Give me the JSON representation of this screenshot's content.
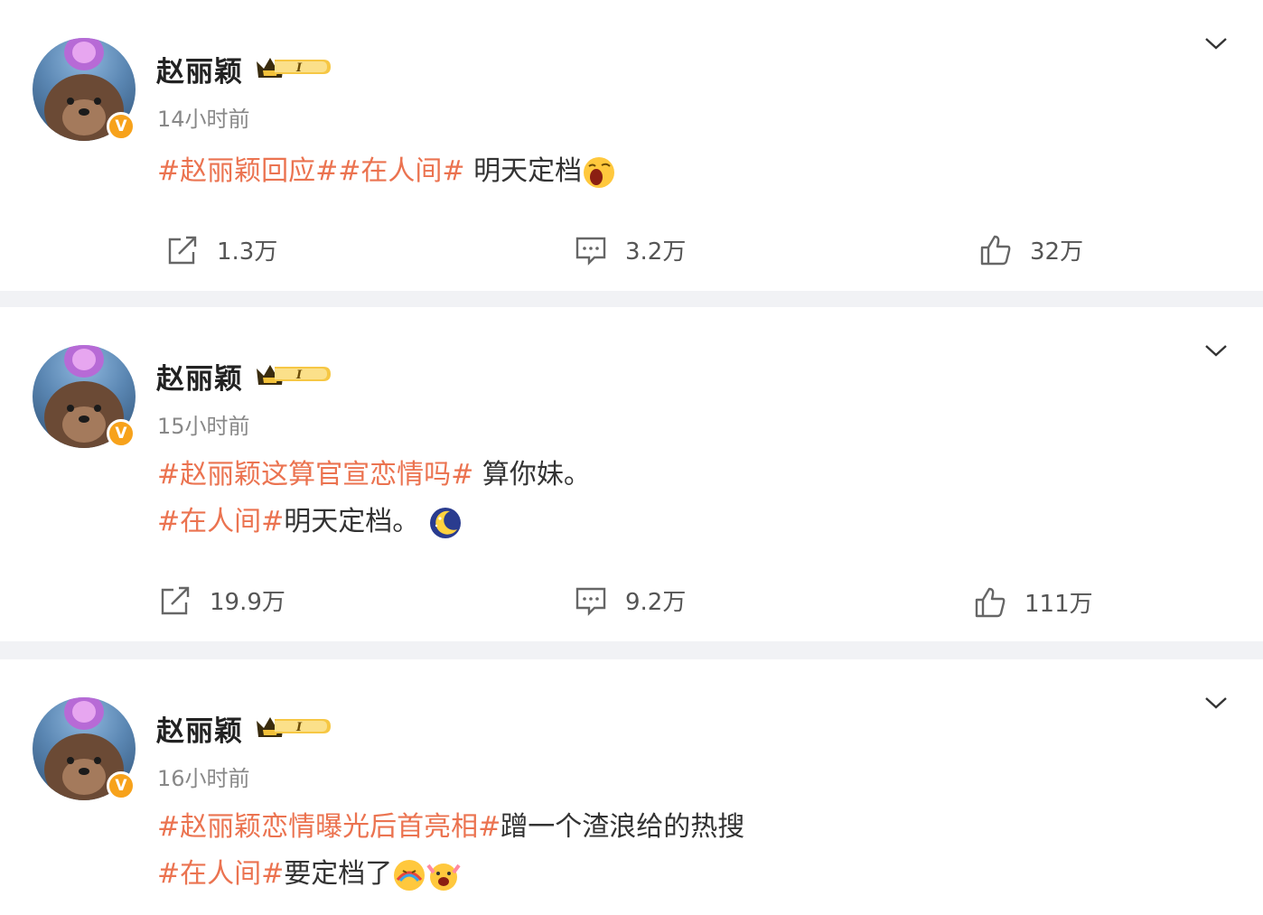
{
  "posts": [
    {
      "username": "赵丽颖",
      "verified_badge": "V",
      "vip_icon": "crown-vip-level-icon",
      "time": "14小时前",
      "lines": [
        {
          "segments": [
            {
              "type": "tag",
              "text": "#赵丽颖回应##在人间#"
            },
            {
              "type": "text",
              "text": " 明天定档"
            }
          ],
          "emojis": [
            "yawn-emoji"
          ]
        }
      ],
      "actions": {
        "repost": "1.3万",
        "comment": "3.2万",
        "like": "32万"
      }
    },
    {
      "username": "赵丽颖",
      "verified_badge": "V",
      "vip_icon": "crown-vip-level-icon",
      "time": "15小时前",
      "lines": [
        {
          "segments": [
            {
              "type": "tag",
              "text": "#赵丽颖这算官宣恋情吗#"
            },
            {
              "type": "text",
              "text": " 算你妹。"
            }
          ],
          "emojis": []
        },
        {
          "segments": [
            {
              "type": "tag",
              "text": "#在人间#"
            },
            {
              "type": "text",
              "text": "明天定档。"
            }
          ],
          "emojis": [
            "moon-emoji"
          ]
        }
      ],
      "actions": {
        "repost": "19.9万",
        "comment": "9.2万",
        "like": "111万"
      }
    },
    {
      "username": "赵丽颖",
      "verified_badge": "V",
      "vip_icon": "crown-vip-level-icon",
      "time": "16小时前",
      "lines": [
        {
          "segments": [
            {
              "type": "tag",
              "text": "#赵丽颖恋情曝光后首亮相#"
            },
            {
              "type": "text",
              "text": "蹭一个渣浪给的热搜"
            }
          ],
          "emojis": []
        },
        {
          "segments": [
            {
              "type": "tag",
              "text": "#在人间#"
            },
            {
              "type": "text",
              "text": "要定档了"
            }
          ],
          "emojis": [
            "rainbow-emoji",
            "cheer-emoji"
          ]
        }
      ],
      "actions": {
        "repost": "",
        "comment": "",
        "like": ""
      }
    }
  ],
  "colors": {
    "tag": "#eb7350",
    "badge": "#f7a21b",
    "muted": "#888888",
    "separator": "#f1f2f5"
  }
}
